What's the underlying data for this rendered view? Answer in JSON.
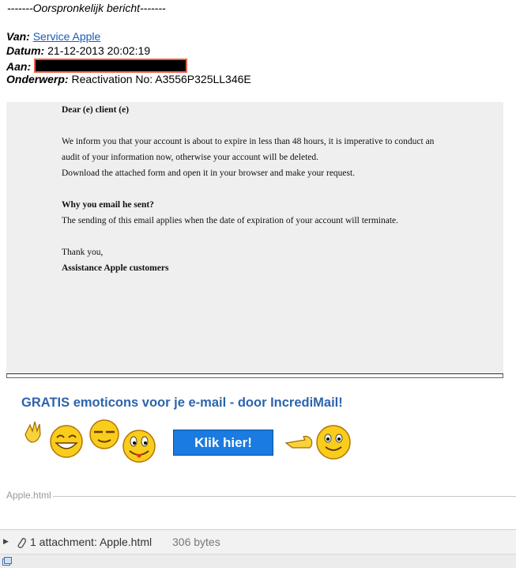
{
  "original_message_label": "-------Oorspronkelijk bericht-------",
  "headers": {
    "from_label": "Van:",
    "from_value": "Service Apple",
    "date_label": "Datum:",
    "date_value": "21-12-2013 20:02:19",
    "to_label": "Aan:",
    "subject_label": "Onderwerp:",
    "subject_value": "Reactivation No: A3556P325LL346E"
  },
  "message": {
    "greeting": "Dear (e) client (e)",
    "para1_line1": "We inform you that your account is about to expire in less than 48 hours, it is imperative to conduct an",
    "para1_line2": "audit of your information now, otherwise your account will be deleted.",
    "para1_line3": "Download the attached form and open it in your browser and make your request.",
    "question": "Why you email he sent?",
    "answer": "The sending of this email applies when the date of expiration of your account will terminate.",
    "thanks": "Thank you,",
    "signature": "Assistance Apple customers"
  },
  "promo": {
    "title": "GRATIS emoticons voor je e-mail - door IncrediMail!",
    "button_label": "Klik hier!"
  },
  "attachment_inline_name": "Apple.html",
  "attachment_bar": {
    "count_label": "1 attachment: Apple.html",
    "size": "306 bytes"
  },
  "colors": {
    "link": "#1a5bb8",
    "promo_title": "#2d64ad",
    "button": "#1a7be0",
    "redaction_border": "#e8604c",
    "message_bg": "#efefef"
  },
  "icons": [
    "paperclip-icon",
    "expand-triangle-icon",
    "status-icon",
    "emoticon-icon"
  ]
}
